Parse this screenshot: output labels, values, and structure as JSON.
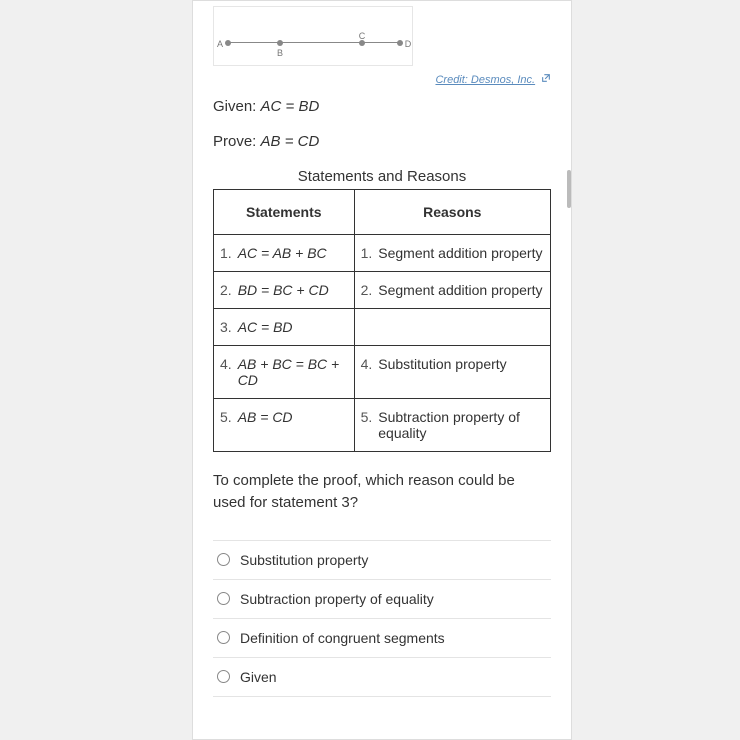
{
  "diagram": {
    "points": [
      "A",
      "B",
      "C",
      "D"
    ]
  },
  "credit": {
    "text": "Credit: Desmos, Inc.",
    "icon": "external-link"
  },
  "given": {
    "prefix": "Given: ",
    "expr": "AC = BD"
  },
  "prove": {
    "prefix": "Prove: ",
    "expr": "AB = CD"
  },
  "table": {
    "caption": "Statements and Reasons",
    "headers": {
      "statements": "Statements",
      "reasons": "Reasons"
    },
    "rows": [
      {
        "sn": "1.",
        "statement": "AC = AB + BC",
        "rn": "1.",
        "reason": "Segment addition property"
      },
      {
        "sn": "2.",
        "statement": "BD = BC + CD",
        "rn": "2.",
        "reason": "Segment addition property"
      },
      {
        "sn": "3.",
        "statement": "AC = BD",
        "rn": "",
        "reason": ""
      },
      {
        "sn": "4.",
        "statement": "AB + BC = BC + CD",
        "rn": "4.",
        "reason": "Substitution property"
      },
      {
        "sn": "5.",
        "statement": "AB = CD",
        "rn": "5.",
        "reason": "Subtraction property of equality"
      }
    ]
  },
  "question": "To complete the proof, which reason could be used for statement 3?",
  "options": [
    "Substitution property",
    "Subtraction property of equality",
    "Definition of congruent segments",
    "Given"
  ]
}
